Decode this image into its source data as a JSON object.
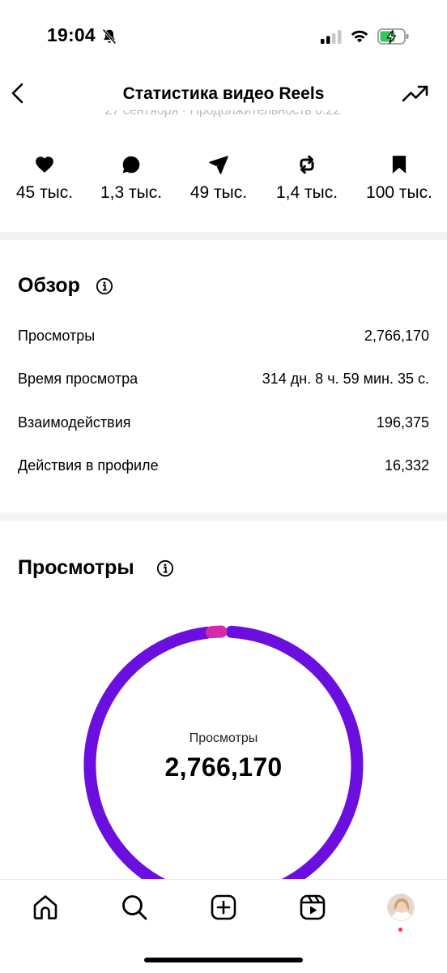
{
  "status_bar": {
    "time": "19:04"
  },
  "header": {
    "title": "Статистика видео Reels"
  },
  "subtitle_fragment": "27 сентября · Продолжительность 0:22",
  "metrics": [
    {
      "icon": "heart-icon",
      "value": "45 тыс."
    },
    {
      "icon": "comment-icon",
      "value": "1,3 тыс."
    },
    {
      "icon": "send-icon",
      "value": "49 тыс."
    },
    {
      "icon": "repost-icon",
      "value": "1,4 тыс."
    },
    {
      "icon": "bookmark-icon",
      "value": "100 тыс."
    }
  ],
  "overview": {
    "title": "Обзор",
    "rows": [
      {
        "label": "Просмотры",
        "value": "2,766,170"
      },
      {
        "label": "Время просмотра",
        "value": "314 дн. 8 ч. 59 мин. 35 с."
      },
      {
        "label": "Взаимодействия",
        "value": "196,375"
      },
      {
        "label": "Действия в профиле",
        "value": "16,332"
      }
    ]
  },
  "views": {
    "title": "Просмотры",
    "caption": "Просмотры",
    "total": "2,766,170",
    "chart": {
      "type": "donut",
      "segments": [
        {
          "color": "#6a0fe0",
          "share": 0.985
        },
        {
          "color": "#d62aa8",
          "share": 0.015
        }
      ]
    }
  },
  "colors": {
    "primary_segment": "#6a0fe0",
    "secondary_segment": "#d62aa8",
    "notification_dot": "#ff3040",
    "separator": "#f2f3f5"
  },
  "tab_bar": [
    "home-icon",
    "search-icon",
    "create-icon",
    "reels-icon",
    "profile-avatar"
  ]
}
